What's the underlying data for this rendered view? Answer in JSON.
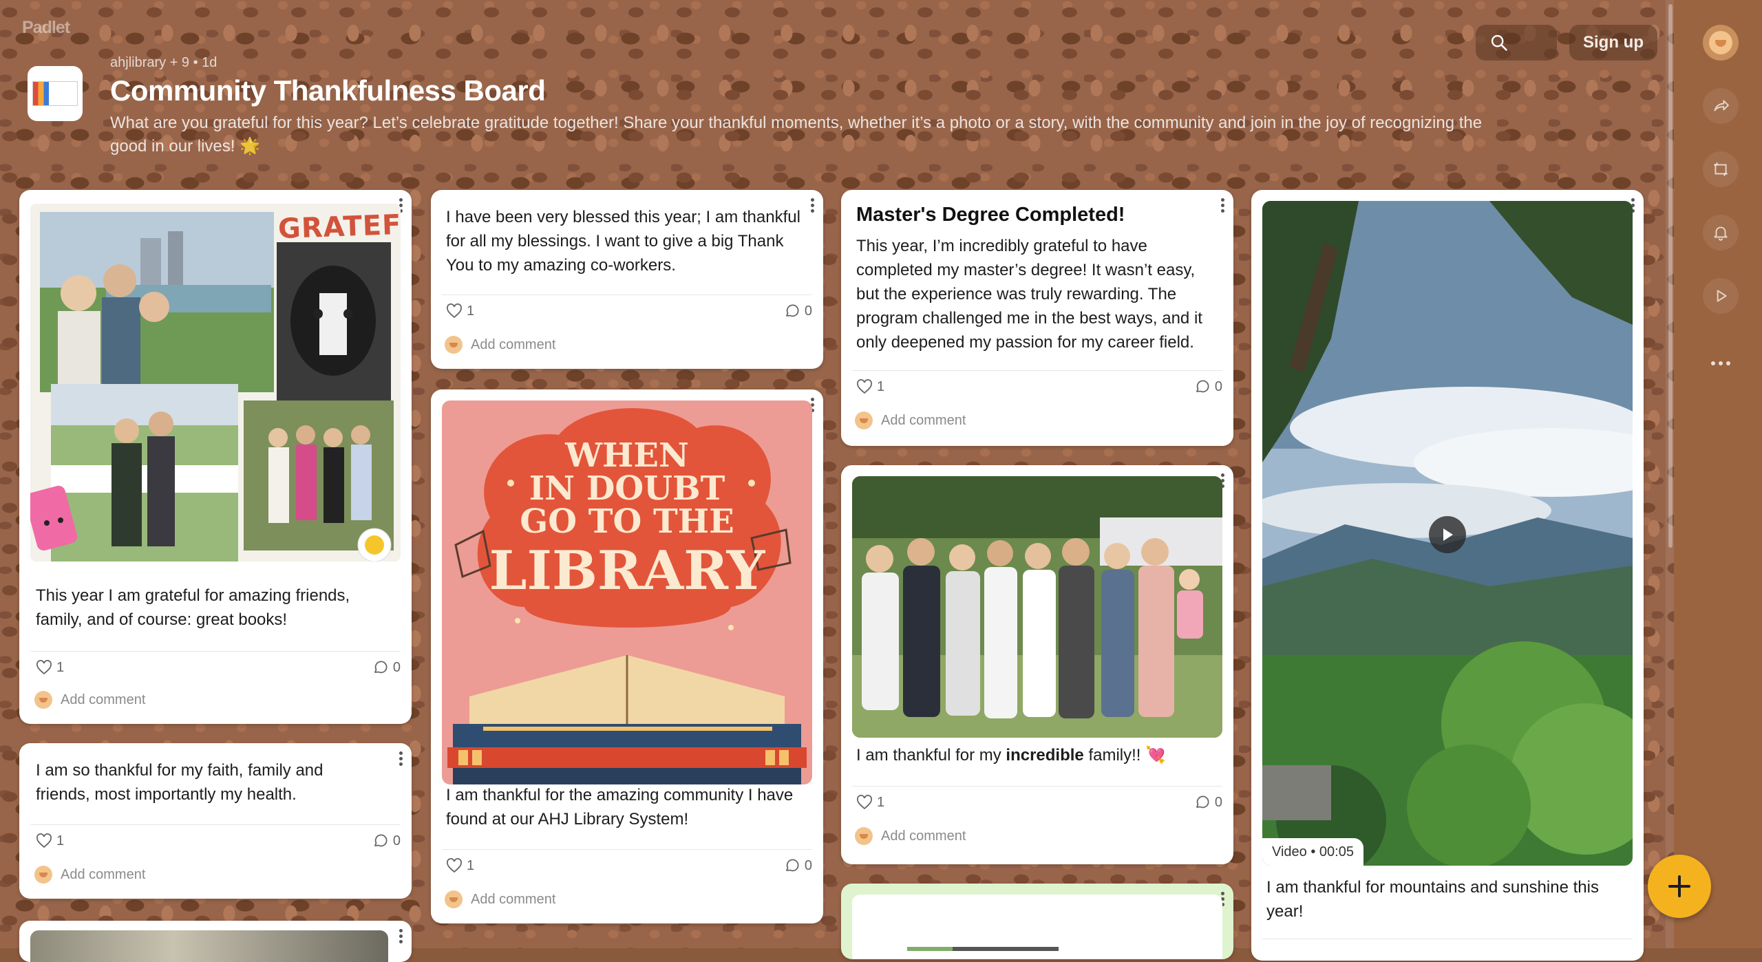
{
  "app": {
    "logo": "Padlet"
  },
  "header": {
    "search_icon": "search-icon",
    "signup_label": "Sign up"
  },
  "board": {
    "meta": "ahjlibrary + 9 • 1d",
    "title": "Community Thankfulness Board",
    "description": "What are you grateful for this year? Let’s celebrate gratitude together! Share your thankful moments, whether it’s a photo or a story, with the community and join in the joy of recognizing the good in our lives! 🌟"
  },
  "sidebar": {
    "items": [
      "avatar",
      "share-icon",
      "remake-icon",
      "bell-icon",
      "play-icon",
      "more-icon"
    ]
  },
  "posts": [
    {
      "text": "This year I am grateful for amazing friends, family, and of course: great books!",
      "image_caption": "GRATEFUL",
      "likes": "1",
      "comments": "0",
      "comment_placeholder": "Add comment"
    },
    {
      "text": "I am so thankful for my faith, family and friends, most importantly my health.",
      "likes": "1",
      "comments": "0",
      "comment_placeholder": "Add comment"
    },
    {
      "text": "I have been very blessed this year; I am thankful for all my blessings. I want to give a big Thank You to my amazing co-workers.",
      "likes": "1",
      "comments": "0",
      "comment_placeholder": "Add comment"
    },
    {
      "poster_lines": [
        "WHEN",
        "IN DOUBT",
        "GO TO THE",
        "LIBRARY"
      ],
      "text": "I am thankful for the amazing community I have found at our AHJ Library System!",
      "likes": "1",
      "comments": "0",
      "comment_placeholder": "Add comment"
    },
    {
      "title": "Master's Degree Completed!",
      "text": "This year, I’m incredibly grateful to have completed my master’s degree! It wasn’t easy, but the experience was truly rewarding. The program challenged me in the best ways, and it only deepened my passion for my career field.",
      "likes": "1",
      "comments": "0",
      "comment_placeholder": "Add comment"
    },
    {
      "text_before": "I am thankful for my ",
      "text_bold": "incredible",
      "text_after": " family!! 💘",
      "likes": "1",
      "comments": "0",
      "comment_placeholder": "Add comment"
    },
    {
      "video_label": "Video • 00:05",
      "text": "I am thankful for mountains and sunshine this year!"
    }
  ],
  "fab_label": "+"
}
